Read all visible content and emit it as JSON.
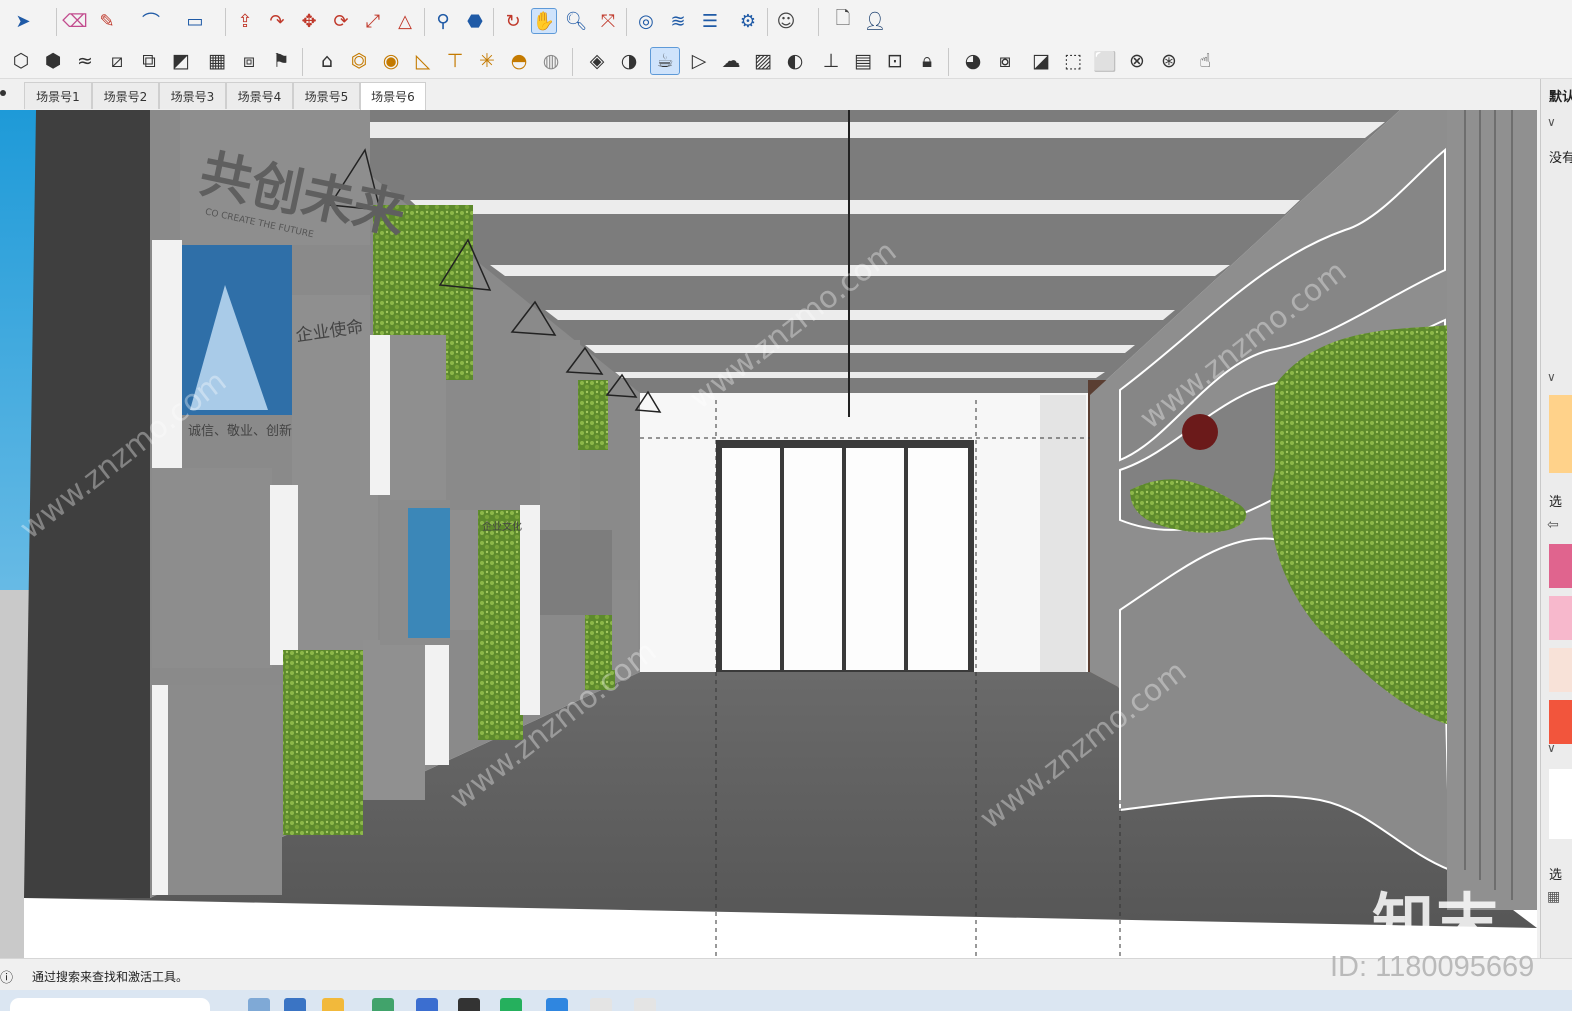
{
  "scene_tabs": [
    "场景号1",
    "场景号2",
    "场景号3",
    "场景号4",
    "场景号5",
    "场景号6"
  ],
  "active_scene_tab": "场景号6",
  "status_text": "通过搜索来查找和激活工具。",
  "right_panel": {
    "header": "默认",
    "label_1": "没有",
    "label_2": "选",
    "label_3": "选"
  },
  "wall_text": {
    "big_title": "共创未来",
    "title_sub": "CO CREATE THE FUTURE",
    "mission_title": "企业使命",
    "values": "诚信、敬业、创新",
    "culture": "企业文化"
  },
  "watermark": {
    "logo": "知末",
    "id": "ID: 1180095669",
    "site": "www.znzmo.com",
    "site_cn": "知末网"
  },
  "colors": {
    "toolbar_icon": "#1f5aa6",
    "wall_gray": "#8e8e8e",
    "ceiling_gray": "#7a7a7a",
    "floor_gray": "#5c5c5c",
    "greenery": "#6f9a3a",
    "sky_blue": "#2aa5e0"
  }
}
